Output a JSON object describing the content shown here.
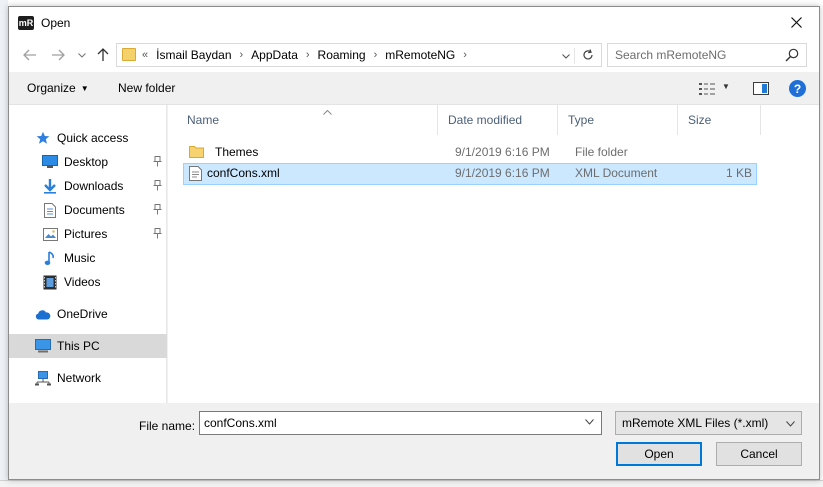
{
  "window": {
    "title": "Open",
    "app_icon_text": "mR"
  },
  "address_bar": {
    "overflow": "«",
    "crumbs": [
      "İsmail Baydan",
      "AppData",
      "Roaming",
      "mRemoteNG"
    ],
    "search_placeholder": "Search mRemoteNG"
  },
  "toolbar": {
    "organize_label": "Organize",
    "new_folder_label": "New folder"
  },
  "sidebar": {
    "items": [
      {
        "label": "Quick access",
        "icon": "star-icon"
      },
      {
        "label": "Desktop",
        "icon": "desktop-icon",
        "pinned": true
      },
      {
        "label": "Downloads",
        "icon": "download-icon",
        "pinned": true
      },
      {
        "label": "Documents",
        "icon": "document-icon",
        "pinned": true
      },
      {
        "label": "Pictures",
        "icon": "picture-icon",
        "pinned": true
      },
      {
        "label": "Music",
        "icon": "music-icon"
      },
      {
        "label": "Videos",
        "icon": "video-icon"
      },
      {
        "label": "OneDrive",
        "icon": "cloud-icon"
      },
      {
        "label": "This PC",
        "icon": "computer-icon",
        "selected": true
      },
      {
        "label": "Network",
        "icon": "network-icon"
      }
    ]
  },
  "file_list": {
    "columns": [
      "Name",
      "Date modified",
      "Type",
      "Size"
    ],
    "rows": [
      {
        "name": "Themes",
        "date": "9/1/2019 6:16 PM",
        "type": "File folder",
        "size": "",
        "icon": "folder-icon"
      },
      {
        "name": "confCons.xml",
        "date": "9/1/2019 6:16 PM",
        "type": "XML Document",
        "size": "1 KB",
        "icon": "xml-file-icon",
        "selected": true
      }
    ]
  },
  "footer": {
    "file_name_label": "File name:",
    "file_name_value": "confCons.xml",
    "file_type_selected": "mRemote XML Files (*.xml)",
    "open_label": "Open",
    "cancel_label": "Cancel"
  },
  "colors": {
    "accent": "#0078d7",
    "selection": "#cce8ff",
    "header_text": "#4c607a"
  }
}
